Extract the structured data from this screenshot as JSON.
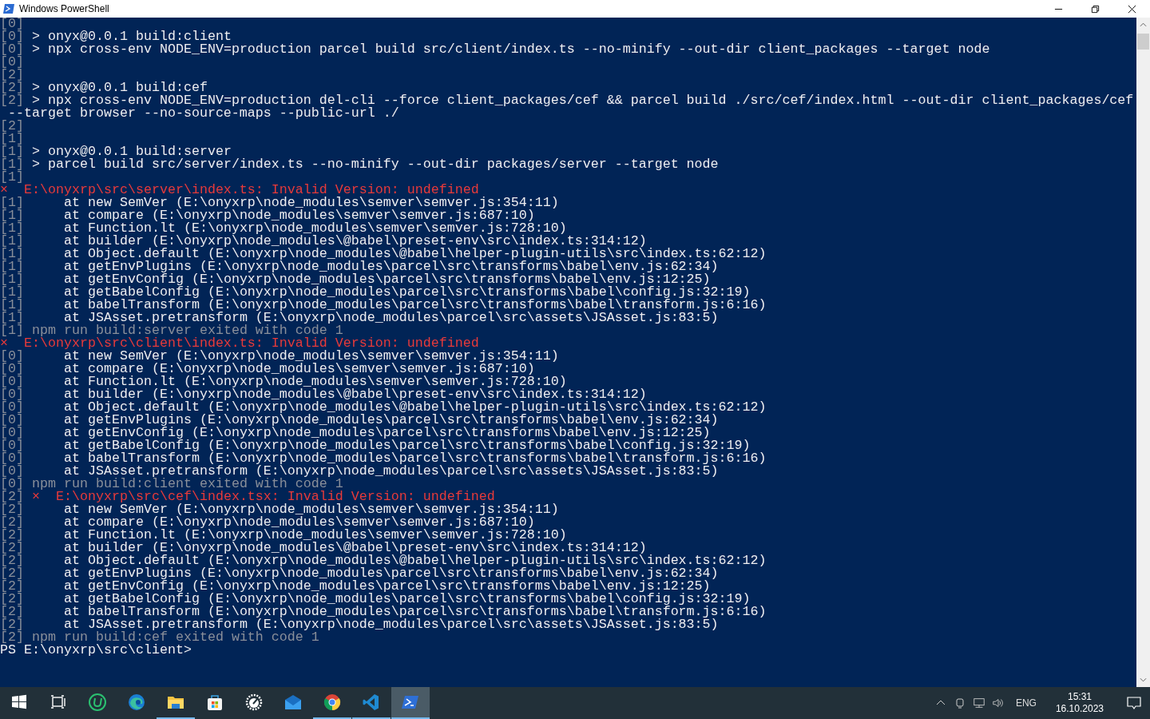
{
  "window": {
    "title": "Windows PowerShell"
  },
  "console": {
    "lines": [
      {
        "kind": "plain",
        "prefix": "[0]"
      },
      {
        "kind": "plain",
        "prefix": "[0]",
        "text": " > onyx@0.0.1 build:client"
      },
      {
        "kind": "plain",
        "prefix": "[0]",
        "text": " > npx cross-env NODE_ENV=production parcel build src/client/index.ts --no-minify --out-dir client_packages --target node"
      },
      {
        "kind": "plain",
        "prefix": "[0]"
      },
      {
        "kind": "plain",
        "prefix": "[2]"
      },
      {
        "kind": "plain",
        "prefix": "[2]",
        "text": " > onyx@0.0.1 build:cef"
      },
      {
        "kind": "plain",
        "prefix": "[2]",
        "text": " > npx cross-env NODE_ENV=production del-cli --force client_packages/cef && parcel build ./src/cef/index.html --out-dir client_packages/cef"
      },
      {
        "kind": "plain",
        "text": " --target browser --no-source-maps --public-url ./"
      },
      {
        "kind": "plain",
        "prefix": "[2]"
      },
      {
        "kind": "plain",
        "prefix": "[1]"
      },
      {
        "kind": "plain",
        "prefix": "[1]",
        "text": " > onyx@0.0.1 build:server"
      },
      {
        "kind": "plain",
        "prefix": "[1]",
        "text": " > parcel build src/server/index.ts --no-minify --out-dir packages/server --target node"
      },
      {
        "kind": "plain",
        "prefix": "[1]"
      },
      {
        "kind": "error",
        "text": "×  E:\\onyxrp\\src\\server\\index.ts: Invalid Version: undefined"
      },
      {
        "kind": "plain",
        "prefix": "[1]",
        "text": "     at new SemVer (E:\\onyxrp\\node_modules\\semver\\semver.js:354:11)"
      },
      {
        "kind": "plain",
        "prefix": "[1]",
        "text": "     at compare (E:\\onyxrp\\node_modules\\semver\\semver.js:687:10)"
      },
      {
        "kind": "plain",
        "prefix": "[1]",
        "text": "     at Function.lt (E:\\onyxrp\\node_modules\\semver\\semver.js:728:10)"
      },
      {
        "kind": "plain",
        "prefix": "[1]",
        "text": "     at builder (E:\\onyxrp\\node_modules\\@babel\\preset-env\\src\\index.ts:314:12)"
      },
      {
        "kind": "plain",
        "prefix": "[1]",
        "text": "     at Object.default (E:\\onyxrp\\node_modules\\@babel\\helper-plugin-utils\\src\\index.ts:62:12)"
      },
      {
        "kind": "plain",
        "prefix": "[1]",
        "text": "     at getEnvPlugins (E:\\onyxrp\\node_modules\\parcel\\src\\transforms\\babel\\env.js:62:34)"
      },
      {
        "kind": "plain",
        "prefix": "[1]",
        "text": "     at getEnvConfig (E:\\onyxrp\\node_modules\\parcel\\src\\transforms\\babel\\env.js:12:25)"
      },
      {
        "kind": "plain",
        "prefix": "[1]",
        "text": "     at getBabelConfig (E:\\onyxrp\\node_modules\\parcel\\src\\transforms\\babel\\config.js:32:19)"
      },
      {
        "kind": "plain",
        "prefix": "[1]",
        "text": "     at babelTransform (E:\\onyxrp\\node_modules\\parcel\\src\\transforms\\babel\\transform.js:6:16)"
      },
      {
        "kind": "plain",
        "prefix": "[1]",
        "text": "     at JSAsset.pretransform (E:\\onyxrp\\node_modules\\parcel\\src\\assets\\JSAsset.js:83:5)"
      },
      {
        "kind": "exit",
        "prefix": "[1]",
        "text": " npm run build:server exited with code 1"
      },
      {
        "kind": "error",
        "text": "×  E:\\onyxrp\\src\\client\\index.ts: Invalid Version: undefined"
      },
      {
        "kind": "plain",
        "prefix": "[0]",
        "text": "     at new SemVer (E:\\onyxrp\\node_modules\\semver\\semver.js:354:11)"
      },
      {
        "kind": "plain",
        "prefix": "[0]",
        "text": "     at compare (E:\\onyxrp\\node_modules\\semver\\semver.js:687:10)"
      },
      {
        "kind": "plain",
        "prefix": "[0]",
        "text": "     at Function.lt (E:\\onyxrp\\node_modules\\semver\\semver.js:728:10)"
      },
      {
        "kind": "plain",
        "prefix": "[0]",
        "text": "     at builder (E:\\onyxrp\\node_modules\\@babel\\preset-env\\src\\index.ts:314:12)"
      },
      {
        "kind": "plain",
        "prefix": "[0]",
        "text": "     at Object.default (E:\\onyxrp\\node_modules\\@babel\\helper-plugin-utils\\src\\index.ts:62:12)"
      },
      {
        "kind": "plain",
        "prefix": "[0]",
        "text": "     at getEnvPlugins (E:\\onyxrp\\node_modules\\parcel\\src\\transforms\\babel\\env.js:62:34)"
      },
      {
        "kind": "plain",
        "prefix": "[0]",
        "text": "     at getEnvConfig (E:\\onyxrp\\node_modules\\parcel\\src\\transforms\\babel\\env.js:12:25)"
      },
      {
        "kind": "plain",
        "prefix": "[0]",
        "text": "     at getBabelConfig (E:\\onyxrp\\node_modules\\parcel\\src\\transforms\\babel\\config.js:32:19)"
      },
      {
        "kind": "plain",
        "prefix": "[0]",
        "text": "     at babelTransform (E:\\onyxrp\\node_modules\\parcel\\src\\transforms\\babel\\transform.js:6:16)"
      },
      {
        "kind": "plain",
        "prefix": "[0]",
        "text": "     at JSAsset.pretransform (E:\\onyxrp\\node_modules\\parcel\\src\\assets\\JSAsset.js:83:5)"
      },
      {
        "kind": "exit",
        "prefix": "[0]",
        "text": " npm run build:client exited with code 1"
      },
      {
        "kind": "error",
        "prefix": "[2]",
        "text": " ×  E:\\onyxrp\\src\\cef\\index.tsx: Invalid Version: undefined"
      },
      {
        "kind": "plain",
        "prefix": "[2]",
        "text": "     at new SemVer (E:\\onyxrp\\node_modules\\semver\\semver.js:354:11)"
      },
      {
        "kind": "plain",
        "prefix": "[2]",
        "text": "     at compare (E:\\onyxrp\\node_modules\\semver\\semver.js:687:10)"
      },
      {
        "kind": "plain",
        "prefix": "[2]",
        "text": "     at Function.lt (E:\\onyxrp\\node_modules\\semver\\semver.js:728:10)"
      },
      {
        "kind": "plain",
        "prefix": "[2]",
        "text": "     at builder (E:\\onyxrp\\node_modules\\@babel\\preset-env\\src\\index.ts:314:12)"
      },
      {
        "kind": "plain",
        "prefix": "[2]",
        "text": "     at Object.default (E:\\onyxrp\\node_modules\\@babel\\helper-plugin-utils\\src\\index.ts:62:12)"
      },
      {
        "kind": "plain",
        "prefix": "[2]",
        "text": "     at getEnvPlugins (E:\\onyxrp\\node_modules\\parcel\\src\\transforms\\babel\\env.js:62:34)"
      },
      {
        "kind": "plain",
        "prefix": "[2]",
        "text": "     at getEnvConfig (E:\\onyxrp\\node_modules\\parcel\\src\\transforms\\babel\\env.js:12:25)"
      },
      {
        "kind": "plain",
        "prefix": "[2]",
        "text": "     at getBabelConfig (E:\\onyxrp\\node_modules\\parcel\\src\\transforms\\babel\\config.js:32:19)"
      },
      {
        "kind": "plain",
        "prefix": "[2]",
        "text": "     at babelTransform (E:\\onyxrp\\node_modules\\parcel\\src\\transforms\\babel\\transform.js:6:16)"
      },
      {
        "kind": "plain",
        "prefix": "[2]",
        "text": "     at JSAsset.pretransform (E:\\onyxrp\\node_modules\\parcel\\src\\assets\\JSAsset.js:83:5)"
      },
      {
        "kind": "exit",
        "prefix": "[2]",
        "text": " npm run build:cef exited with code 1"
      },
      {
        "kind": "prompt",
        "text": "PS E:\\onyxrp\\src\\client>"
      }
    ]
  },
  "taskbar": {
    "apps": [
      {
        "running": false,
        "selected": false
      },
      {
        "running": false,
        "selected": false
      },
      {
        "running": false,
        "selected": false
      },
      {
        "running": false,
        "selected": false
      },
      {
        "running": true,
        "selected": false
      },
      {
        "running": false,
        "selected": false
      },
      {
        "running": false,
        "selected": false
      },
      {
        "running": false,
        "selected": false
      },
      {
        "running": true,
        "selected": false
      },
      {
        "running": true,
        "selected": false
      },
      {
        "running": true,
        "selected": true
      }
    ],
    "tray": {
      "language": "ENG",
      "time": "15:31",
      "date": "16.10.2023"
    }
  }
}
